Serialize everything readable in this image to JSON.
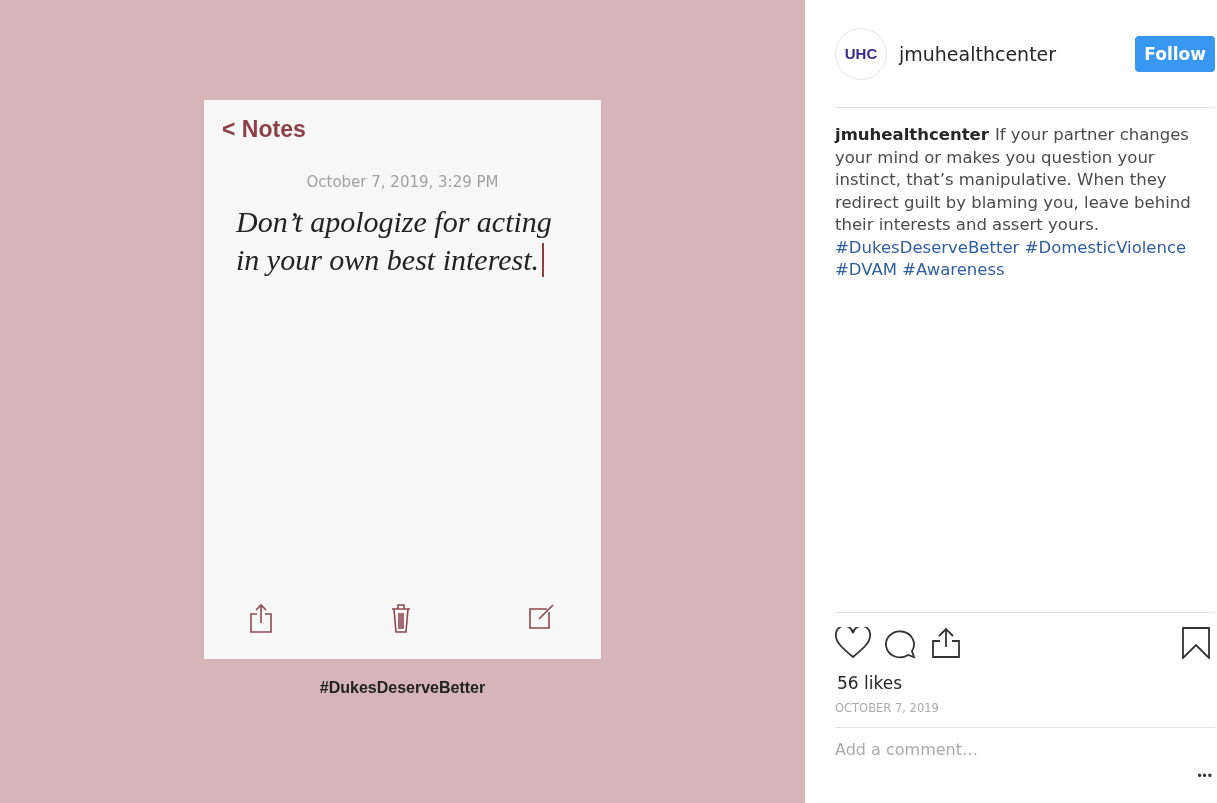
{
  "post_image": {
    "notes_card": {
      "back_label": "< Notes",
      "date": "October 7, 2019, 3:29 PM",
      "note_lines": [
        "Don’t apologize for acting",
        "in your own best interest."
      ],
      "toolbar": [
        {
          "kind": "share"
        },
        {
          "kind": "trash"
        },
        {
          "kind": "compose"
        }
      ]
    },
    "hashtag": "#DukesDeserveBetter"
  },
  "header": {
    "avatar_logo": "UHC",
    "username": "jmuhealthcenter",
    "follow": "Follow"
  },
  "caption": {
    "username": "jmuhealthcenter",
    "text": "If your partner changes your mind or makes you question your instinct, that’s manipulative. When they redirect guilt by blaming you, leave behind their interests and assert yours.",
    "hashtags": [
      "#DukesDeserveBetter",
      "#DomesticViolence",
      "#DVAM",
      "#Awareness"
    ]
  },
  "actions": [
    {
      "kind": "like"
    },
    {
      "kind": "comment"
    },
    {
      "kind": "share"
    },
    {
      "kind": "save"
    }
  ],
  "likes": "56 likes",
  "date": "OCTOBER 7, 2019",
  "comment": {
    "placeholder": "Add a comment…"
  },
  "more": "•••"
}
